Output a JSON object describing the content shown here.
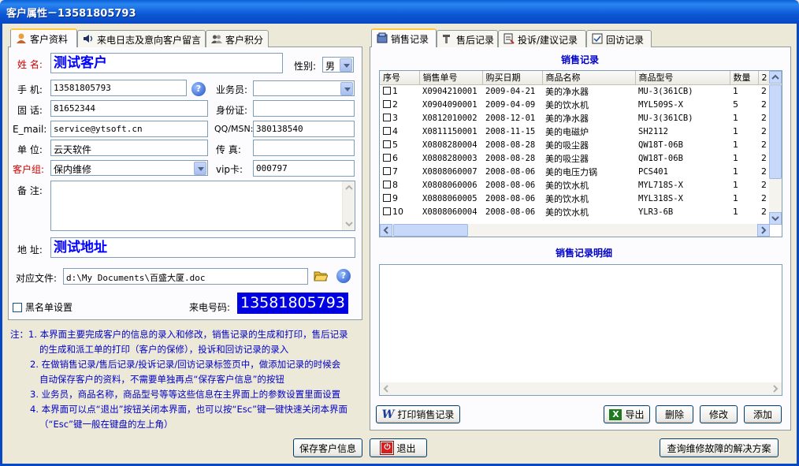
{
  "window": {
    "title": "客户属性－13581805793"
  },
  "left_tabs": [
    {
      "label": "客户资料",
      "icon": "user-icon"
    },
    {
      "label": "来电日志及意向客户留言",
      "icon": "speaker-icon"
    },
    {
      "label": "客户积分",
      "icon": "users-icon"
    }
  ],
  "form": {
    "name_label": "姓 名:",
    "name_value": "测试客户",
    "gender_label": "性别:",
    "gender_value": "男",
    "mobile_label": "手 机:",
    "mobile_value": "13581805793",
    "salesman_label": "业务员:",
    "salesman_value": "",
    "phone_label": "固 话:",
    "phone_value": "81652344",
    "idcard_label": "身份证:",
    "idcard_value": "",
    "email_label": "E_mail:",
    "email_value": "service@ytsoft.cn",
    "qq_label": "QQ/MSN:",
    "qq_value": "380138540",
    "company_label": "单 位:",
    "company_value": "云天软件",
    "fax_label": "传 真:",
    "fax_value": "",
    "group_label": "客户组:",
    "group_value": "保内维修",
    "vip_label": "vip卡:",
    "vip_value": "000797",
    "remark_label": "备 注:",
    "remark_value": "",
    "address_label": "地 址:",
    "address_value": "测试地址",
    "file_label": "对应文件:",
    "file_value": "d:\\My Documents\\百盛大厦.doc",
    "blacklist_label": "黑名单设置",
    "callno_label": "来电号码:",
    "callno_value": "13581805793"
  },
  "notes": [
    "注：1. 本界面主要完成客户的信息的录入和修改，销售记录的生成和打印，售后记录",
    "的生成和派工单的打印（客户的保修），投诉和回访记录的录入",
    "2. 在做销售记录/售后记录/投诉记录/回访记录标签页中，做添加记录的时候会",
    "自动保存客户的资料，不需要单独再点“保存客户信息”的按钮",
    "3. 业务员，商品名称，商品型号等等这些信息在主界面上的参数设置里面设置",
    "4. 本界面可以点“退出”按钮关闭本界面，也可以按“Esc”键一键快速关闭本界面",
    "（“Esc”键一般在键盘的左上角）"
  ],
  "buttons": {
    "save": "保存客户信息",
    "exit": "退出",
    "print": "打印销售记录",
    "export": "导出",
    "delete": "删除",
    "modify": "修改",
    "add": "添加",
    "query": "查询维修故障的解决方案"
  },
  "right_tabs": [
    {
      "label": "销售记录",
      "icon": "sales-icon"
    },
    {
      "label": "售后记录",
      "icon": "tools-icon"
    },
    {
      "label": "投诉/建议记录",
      "icon": "complaint-icon"
    },
    {
      "label": "回访记录",
      "icon": "visit-icon"
    }
  ],
  "sales_grid": {
    "title": "销售记录",
    "columns": [
      "序号",
      "销售单号",
      "购买日期",
      "商品名称",
      "商品型号",
      "数量",
      "2"
    ],
    "rows": [
      [
        "1",
        "X0904210001",
        "2009-04-21",
        "美的净水器",
        "MU-3(361CB)",
        "1",
        "2"
      ],
      [
        "2",
        "X0904090001",
        "2009-04-09",
        "美的饮水机",
        "MYL509S-X",
        "5",
        "2"
      ],
      [
        "3",
        "X0812010002",
        "2008-12-01",
        "美的净水器",
        "MU-3(361CB)",
        "1",
        "2"
      ],
      [
        "4",
        "X0811150001",
        "2008-11-15",
        "美的电磁炉",
        "SH2112",
        "1",
        "2"
      ],
      [
        "5",
        "X0808280004",
        "2008-08-28",
        "美的吸尘器",
        "QW18T-06B",
        "1",
        "2"
      ],
      [
        "6",
        "X0808280003",
        "2008-08-28",
        "美的吸尘器",
        "QW18T-06B",
        "1",
        "2"
      ],
      [
        "7",
        "X0808060007",
        "2008-08-06",
        "美的电压力锅",
        "PCS401",
        "1",
        "2"
      ],
      [
        "8",
        "X0808060006",
        "2008-08-06",
        "美的饮水机",
        "MYL718S-X",
        "1",
        "2"
      ],
      [
        "9",
        "X0808060005",
        "2008-08-06",
        "美的饮水机",
        "MYL318S-X",
        "1",
        "2"
      ],
      [
        "10",
        "X0808060004",
        "2008-08-06",
        "美的饮水机",
        "YLR3-6B",
        "1",
        "2"
      ]
    ]
  },
  "detail_grid": {
    "title": "销售记录明细"
  }
}
